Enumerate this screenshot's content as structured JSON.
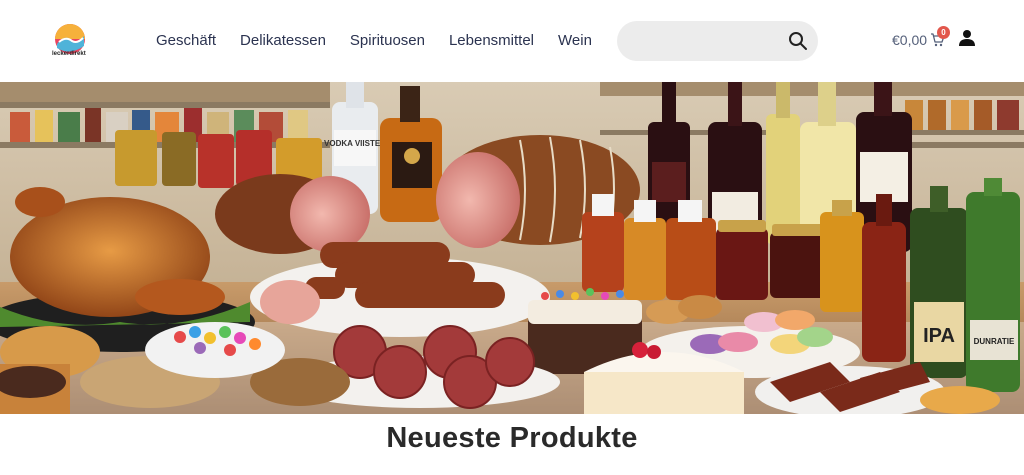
{
  "brand": {
    "name": "leckerdirekt"
  },
  "nav": {
    "items": [
      {
        "label": "Geschäft"
      },
      {
        "label": "Delikatessen"
      },
      {
        "label": "Spirituosen"
      },
      {
        "label": "Lebensmittel"
      },
      {
        "label": "Wein"
      }
    ]
  },
  "search": {
    "value": "",
    "placeholder": ""
  },
  "cart": {
    "total": "€0,00",
    "count": "0"
  },
  "hero": {
    "label_vodka": "VODKA VIISTER",
    "label_ipa": "IPA",
    "label_bottle": "DUNRATIE"
  },
  "section": {
    "title": "Neueste Produkte"
  },
  "colors": {
    "accent": "#e2574c",
    "nav_text": "#2b3350",
    "search_bg": "#ececec"
  }
}
